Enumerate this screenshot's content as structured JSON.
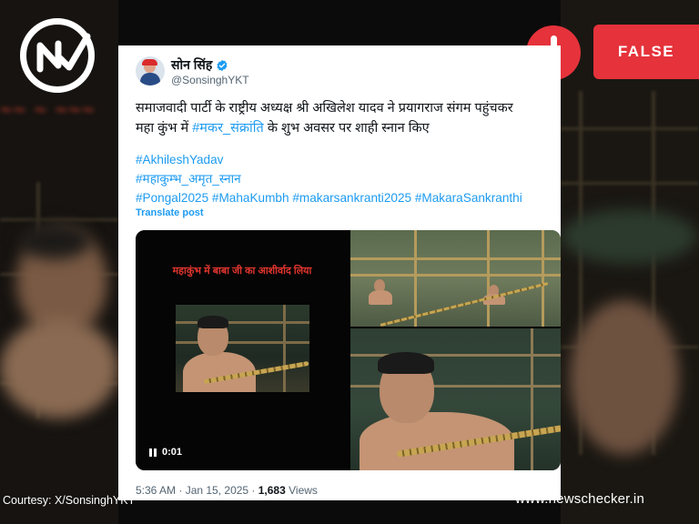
{
  "branding": {
    "logo_icon": "newschecker-check-logo-icon",
    "site": "www.newschecker.in",
    "courtesy": "Courtesy: X/SonsinghYKT"
  },
  "verdict": {
    "icon": "exclamation-alert-icon",
    "label": "FALSE",
    "color": "#e5323b"
  },
  "tweet": {
    "author_name": "सोन सिंह",
    "verified_icon": "verified-badge-icon",
    "handle": "@SonsinghYKT",
    "text_line1": "समाजवादी पार्टी के राष्ट्रीय अध्यक्ष श्री अखिलेश यादव ने प्रयागराज  संगम पहुंचकर",
    "text_line2_start": "महा कुंभ में ",
    "text_link": "#मकर_संक्रांति",
    "text_line2_end": "  के शुभ अवसर पर शाही स्नान किए",
    "hashtags": {
      "h1": "#AkhileshYadav",
      "h2": "#महाकुम्भ_अमृत_स्नान",
      "h3": "#Pongal2025",
      "h4": "#MahaKumbh",
      "h5": "#makarsankranti2025",
      "h6": "#MakaraSankranthi"
    },
    "translate": "Translate post",
    "video_caption": "महाकुंभ में बाबा जी का आशीर्वाद लिया",
    "video_time": "0:01",
    "timestamp": "5:36 AM · Jan 15, 2025 · ",
    "views_count": "1,683",
    "views_label": " Views",
    "link_color": "#1d9bf0"
  }
}
